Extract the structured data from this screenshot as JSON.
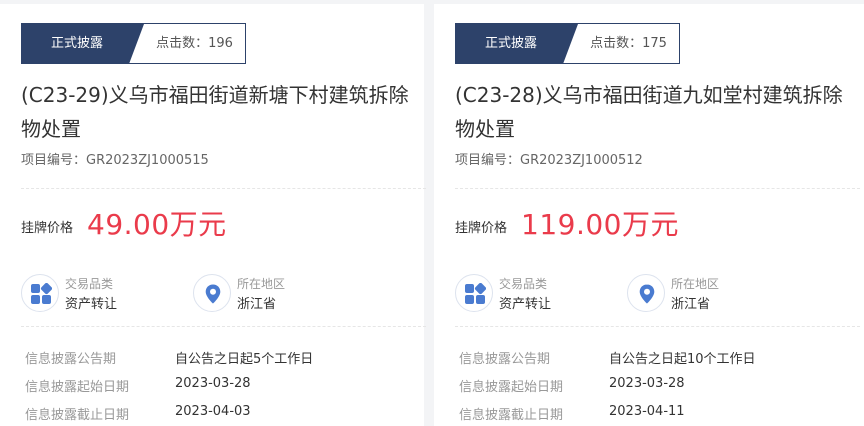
{
  "cards": [
    {
      "status": "正式披露",
      "clicks_label": "点击数：196",
      "title": "(C23-29)义乌市福田街道新塘下村建筑拆除物处置",
      "project_no": "项目编号：GR2023ZJ1000515",
      "price_label": "挂牌价格",
      "price": "49.00万元",
      "category_key": "交易品类",
      "category_val": "资产转让",
      "region_key": "所在地区",
      "region_val": "浙江省",
      "info": [
        {
          "k": "信息披露公告期",
          "v": "自公告之日起5个工作日"
        },
        {
          "k": "信息披露起始日期",
          "v": "2023-03-28"
        },
        {
          "k": "信息披露截止日期",
          "v": "2023-04-03"
        }
      ]
    },
    {
      "status": "正式披露",
      "clicks_label": "点击数：175",
      "title": "(C23-28)义乌市福田街道九如堂村建筑拆除物处置",
      "project_no": "项目编号：GR2023ZJ1000512",
      "price_label": "挂牌价格",
      "price": "119.00万元",
      "category_key": "交易品类",
      "category_val": "资产转让",
      "region_key": "所在地区",
      "region_val": "浙江省",
      "info": [
        {
          "k": "信息披露公告期",
          "v": "自公告之日起10个工作日"
        },
        {
          "k": "信息披露起始日期",
          "v": "2023-03-28"
        },
        {
          "k": "信息披露截止日期",
          "v": "2023-04-11"
        }
      ]
    }
  ],
  "colors": {
    "status_bg": "#2d426a",
    "price": "#ea3b4b",
    "icon": "#4a7bd0"
  },
  "icons": {
    "category": "grid-apps-icon",
    "region": "location-pin-icon"
  }
}
